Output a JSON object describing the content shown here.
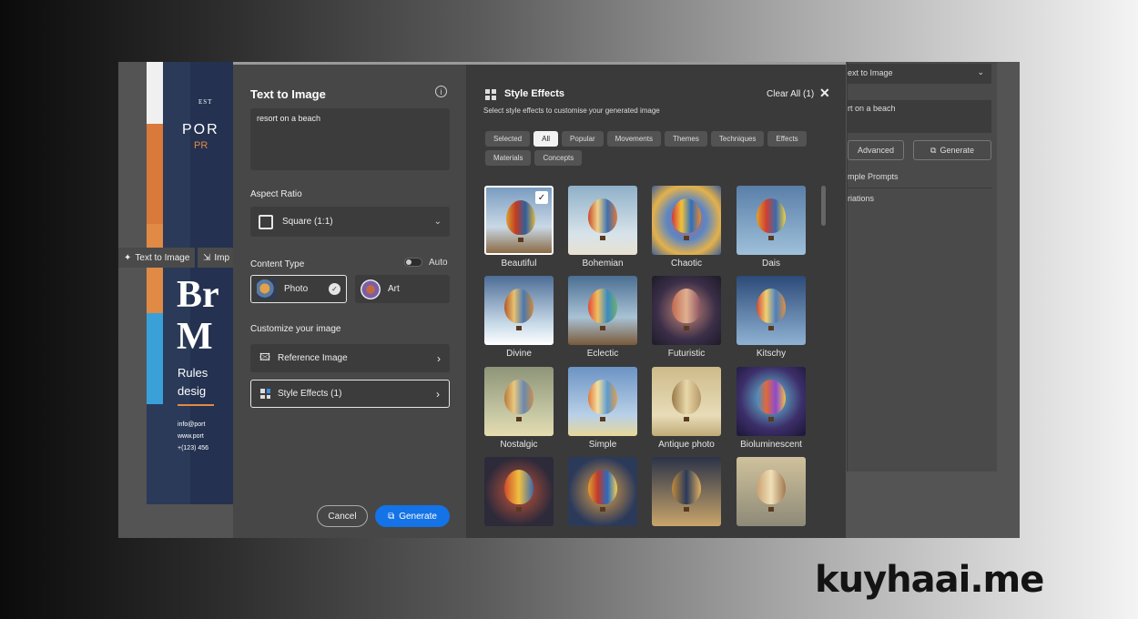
{
  "background": {
    "toolbar": {
      "text_to_image": "Text to Image",
      "import": "Imp"
    },
    "right_panel": {
      "select": "ext to Image",
      "prompt": "rt on a beach",
      "advanced": "Advanced",
      "generate": "Generate",
      "sample_prompts": "mple Prompts",
      "variations": "riations"
    },
    "poster": {
      "line1": "EST",
      "line2": "POR",
      "line3": "PR",
      "big1": "Br",
      "big2": "M",
      "rules": "Rules",
      "design": "desig",
      "info1": "info@port",
      "info2": "www.port",
      "info3": "+(123) 456"
    }
  },
  "dialog": {
    "left": {
      "title": "Text to Image",
      "prompt_value": "resort on a beach",
      "aspect_ratio_label": "Aspect Ratio",
      "aspect_ratio_value": "Square (1:1)",
      "content_type_label": "Content Type",
      "auto_label": "Auto",
      "photo_label": "Photo",
      "art_label": "Art",
      "customize_label": "Customize your image",
      "reference_image": "Reference Image",
      "style_effects": "Style Effects (1)",
      "cancel": "Cancel",
      "generate": "Generate"
    },
    "right": {
      "title": "Style Effects",
      "subtitle": "Select style effects to customise your generated image",
      "clear_all": "Clear All (1)",
      "filters": [
        "Selected",
        "All",
        "Popular",
        "Movements",
        "Themes",
        "Techniques",
        "Effects",
        "Materials",
        "Concepts"
      ],
      "active_filter": "All",
      "styles": [
        "Beautiful",
        "Bohemian",
        "Chaotic",
        "Dais",
        "Divine",
        "Eclectic",
        "Futuristic",
        "Kitschy",
        "Nostalgic",
        "Simple",
        "Antique photo",
        "Bioluminescent",
        "",
        "",
        "",
        ""
      ],
      "selected_style": "Beautiful"
    }
  },
  "watermark": "kuyhaai.me"
}
